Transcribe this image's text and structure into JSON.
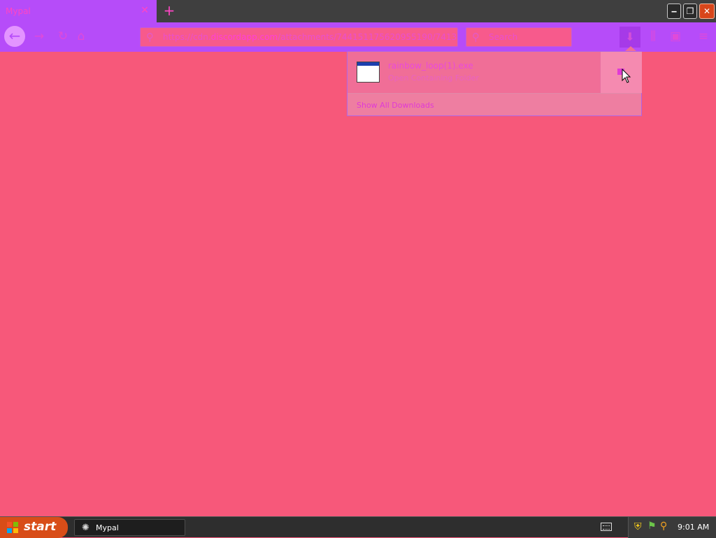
{
  "browser": {
    "tab_title": "Mypal",
    "tab_close": "✕",
    "new_tab": "+",
    "window_buttons": {
      "minimize": "‒",
      "maximize": "❐",
      "close": "✕"
    },
    "nav": {
      "back": "←",
      "forward": "→",
      "reload": "↻",
      "home": "⌂"
    },
    "url": {
      "prefix": "https://cdn.",
      "domain": "discordapp.com",
      "path": "/attachments/744151175620955190/74135837"
    },
    "search_placeholder": "Search",
    "toolbar_icons": {
      "downloads": "⬇",
      "library": "⫼",
      "sidebar": "▣",
      "menu": "≡"
    }
  },
  "downloads_panel": {
    "file_name": "rainbow_loop(1).exe",
    "file_status": "Open Containing Folder",
    "show_all": "Show All Downloads"
  },
  "taskbar": {
    "start_label": "start",
    "task_label": "Mypal",
    "task_icon": "✺",
    "tray_icons": {
      "shield": "⛨",
      "network": "⚑",
      "search": "⚲"
    },
    "clock": "9:01 AM"
  }
}
